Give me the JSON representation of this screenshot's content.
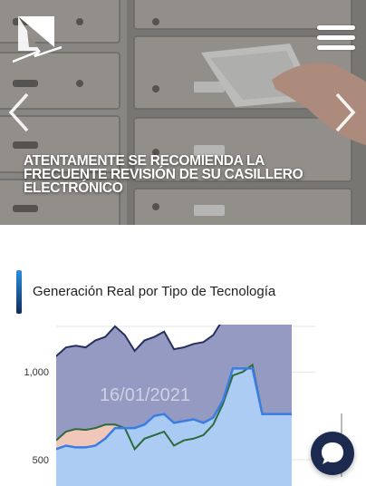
{
  "hero": {
    "caption": "ATENTAMENTE SE RECOMIENDA LA FRECUENTE REVISIÓN DE SU CASILLERO ELECTRÓNICO"
  },
  "chart_section": {
    "title": "Generación Real por Tipo de Tecnología"
  },
  "chart_data": {
    "type": "area",
    "title": "Generación Real por Tipo de Tecnología",
    "watermark": "16/01/2021",
    "y_ticks": [
      "1,000",
      "500"
    ],
    "ylim": [
      350,
      1270
    ],
    "x": [
      0,
      1,
      2,
      3,
      4,
      5,
      6,
      7,
      8,
      9,
      10,
      11,
      12,
      13,
      14,
      15,
      16,
      17,
      18,
      19,
      20,
      21,
      22,
      23,
      24
    ],
    "series": [
      {
        "color": "#8f95bf",
        "values": [
          1090,
          1140,
          1150,
          1140,
          1180,
          1200,
          1260,
          1210,
          1120,
          1180,
          1200,
          1230,
          1130,
          1140,
          1160,
          1170,
          1210,
          1300,
          1340,
          1340,
          1340,
          1340,
          1340,
          1340,
          1340
        ]
      },
      {
        "color": "#f6c9b9",
        "values": [
          610,
          660,
          675,
          670,
          680,
          700,
          700,
          680,
          560,
          620,
          640,
          660,
          580,
          610,
          620,
          640,
          700,
          820,
          980,
          1000,
          1040,
          760,
          760,
          760,
          760
        ]
      },
      {
        "color": "#a9ccf6",
        "values": [
          560,
          580,
          570,
          570,
          580,
          620,
          680,
          680,
          680,
          700,
          750,
          760,
          710,
          720,
          730,
          710,
          740,
          840,
          1020,
          1020,
          1020,
          760,
          760,
          760,
          760
        ]
      }
    ],
    "colors": {
      "darkline": "#26305e",
      "greenline": "#2d6a3e",
      "blueline": "#3a7de3"
    }
  }
}
